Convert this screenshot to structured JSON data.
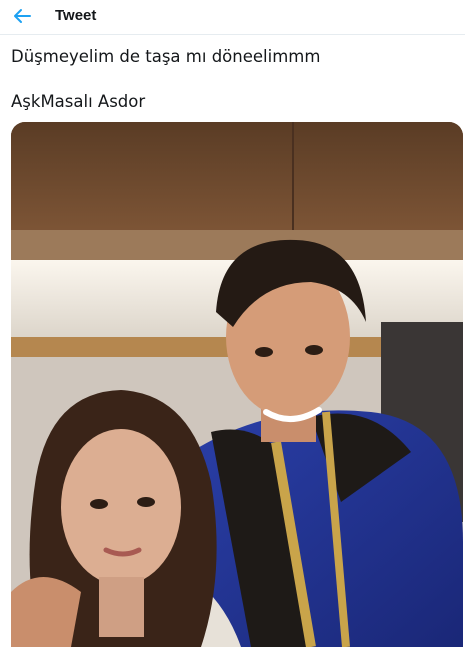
{
  "header": {
    "title": "Tweet",
    "back_icon": "arrow-left-icon",
    "accent_color": "#1da1f2"
  },
  "tweet": {
    "lines": [
      "Düşmeyelim de taşa mı döneelimmm",
      "AşkMasalı Asdor"
    ]
  },
  "media": {
    "type": "photo"
  }
}
